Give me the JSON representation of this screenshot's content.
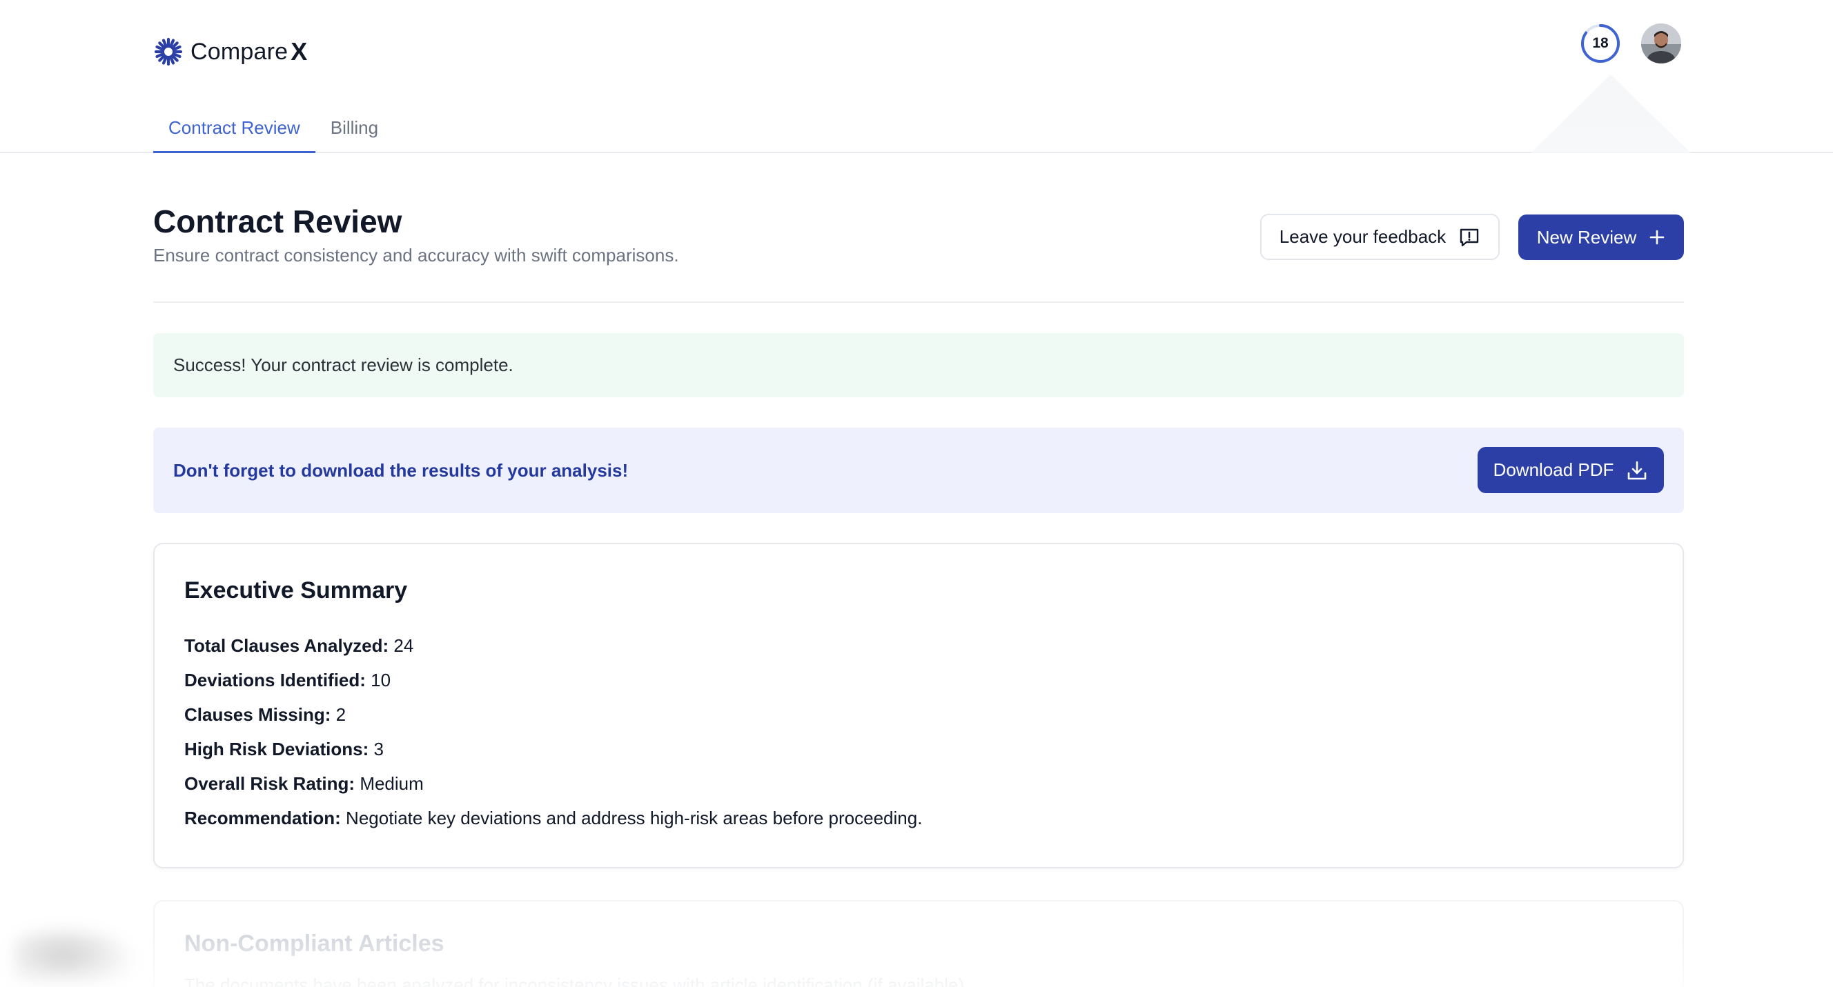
{
  "app": {
    "brand_name": "Compare",
    "brand_x": "X",
    "credits_count": "18",
    "credits_fraction": 0.85,
    "accent_color": "#2b3fa6"
  },
  "tabs": [
    {
      "label": "Contract Review",
      "active": true
    },
    {
      "label": "Billing",
      "active": false
    }
  ],
  "page": {
    "title": "Contract Review",
    "subtitle": "Ensure contract consistency and accuracy with swift comparisons.",
    "feedback_button": "Leave your feedback",
    "new_review_button": "New Review"
  },
  "alerts": {
    "success": "Success! Your contract review is complete.",
    "info": "Don't forget to download the results of your analysis!",
    "download_button": "Download PDF"
  },
  "summary": {
    "title": "Executive Summary",
    "rows": [
      {
        "label": "Total Clauses Analyzed:",
        "value": "24"
      },
      {
        "label": "Deviations Identified:",
        "value": "10"
      },
      {
        "label": "Clauses Missing:",
        "value": "2"
      },
      {
        "label": "High Risk Deviations:",
        "value": "3"
      },
      {
        "label": "Overall Risk Rating:",
        "value": "Medium"
      },
      {
        "label": "Recommendation:",
        "value": "Negotiate key deviations and address high-risk areas before proceeding."
      }
    ]
  },
  "next_section": {
    "title": "Non-Compliant Articles",
    "description": "The documents have been analyzed for inconsistency issues with article identification (if available)."
  }
}
